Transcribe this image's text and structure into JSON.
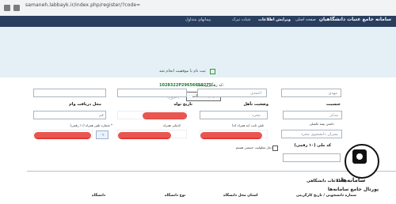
{
  "browser": {
    "url": "samaneh.labbayk.ir/index.php/register/?code="
  },
  "header": {
    "brand": "سامانه جامع عتبات دانشگاهیان",
    "nav_items": [
      "صفحه اصلی",
      "ویرایش اطلاعات",
      "عتبات تبرک",
      "پیمانهای متداول"
    ]
  },
  "success": {
    "message": "ثبت نام با موفقیت انجام شد",
    "tracking_label": "کد رهگیری شما:",
    "tracking_code": "1028322P29656650275",
    "print_button": "چاپ اطلاعات",
    "back_link": "(خروج)"
  },
  "form": {
    "mehdi": "مهدی",
    "ahmadi": "احمدی",
    "gender_label": "جنسیت",
    "gender_value": "مذکر",
    "marital_label": "وضعیت تأهل",
    "marital_value": "مجرد",
    "birth_label": "تاریخ تولد",
    "birth_value": "",
    "place_label": "محل دریافت وام",
    "place_value": "قم",
    "guardian_label": "داشتن بیمه تکمیلی",
    "guardian_value": "پسران دانشجوی مجرد",
    "mobile_label": "شماره تلفن همراه (۱۱ رقمی) *",
    "national_note": "کد ملی (۱۰ رقمی)",
    "national_code_label": "کدملی همراه",
    "phone_label": "تلفن ثابت (به همراه کد)",
    "checkbox": "دچار معلولیت جسمی هستم",
    "mobile_prefix": "۰۹"
  },
  "section": {
    "title": "اطلاعات دانشگاهی",
    "col1": "شماره دانشجویی / تاریخ کارگزینی",
    "col2": "استان محل دانشگاه",
    "col3": "نوع دانشگاه",
    "col4": "دانشگاه"
  },
  "watermark": {
    "text": "سامانه‌ها",
    "subtext": "پورتال جامع سامانه‌ها"
  }
}
